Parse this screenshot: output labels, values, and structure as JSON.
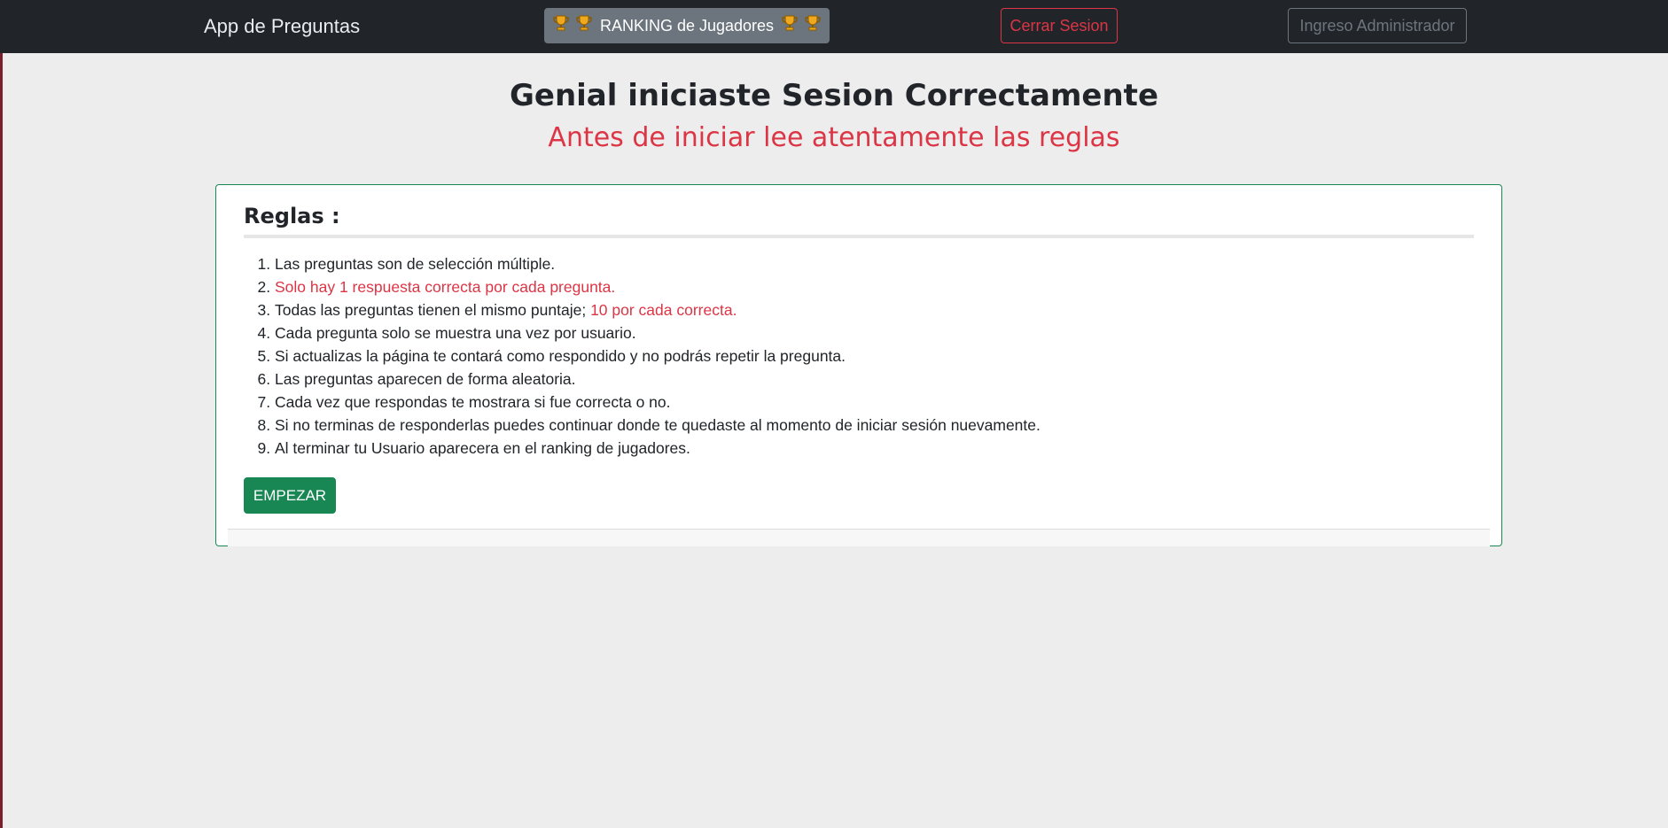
{
  "navbar": {
    "brand": "App de Preguntas",
    "ranking_label": "RANKING de Jugadores",
    "logout_label": "Cerrar Sesion",
    "admin_label": "Ingreso Administrador"
  },
  "main": {
    "title": "Genial iniciaste Sesion Correctamente",
    "subtitle": "Antes de iniciar lee atentamente las reglas"
  },
  "rules": {
    "title": "Reglas :",
    "items": [
      "Las preguntas son de selección múltiple.",
      "Solo hay 1 respuesta correcta por cada pregunta.",
      "Todas las preguntas tienen el mismo puntaje;",
      "Cada pregunta solo se muestra una vez por usuario.",
      "Si actualizas la página te contará como respondido y no podrás repetir la pregunta.",
      "Las preguntas aparecen de forma aleatoria.",
      "Cada vez que respondas te mostrara si fue correcta o no.",
      "Si no terminas de responderlas puedes continuar donde te quedaste al momento de iniciar sesión nuevamente.",
      "Al terminar tu Usuario aparecera en el ranking de jugadores."
    ],
    "item3_highlight": "10 por cada correcta.",
    "start_label": "EMPEZAR"
  },
  "icons": {
    "ranking": "trophy-icon"
  },
  "colors": {
    "navbar": "#212529",
    "danger": "#dc3545",
    "success": "#198754",
    "secondary": "#6c757d",
    "background": "#ededed"
  }
}
